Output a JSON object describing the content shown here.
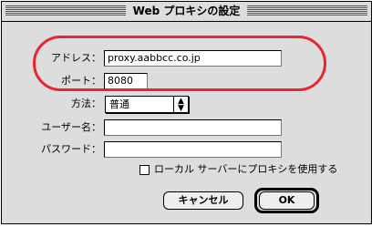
{
  "window": {
    "title": "Web プロキシの設定"
  },
  "form": {
    "address_label": "アドレス：",
    "address_value": "proxy.aabbcc.co.jp",
    "port_label": "ポート：",
    "port_value": "8080",
    "method_label": "方法：",
    "method_value": "普通",
    "username_label": "ユーザー名：",
    "username_value": "",
    "password_label": "パスワード：",
    "password_value": "",
    "local_proxy_checkbox_label": "ローカル サーバーにプロキシを使用する",
    "local_proxy_checked": false
  },
  "buttons": {
    "cancel_label": "キャンセル",
    "ok_label": "OK"
  },
  "annotation": {
    "highlight_color": "#e8262f"
  }
}
